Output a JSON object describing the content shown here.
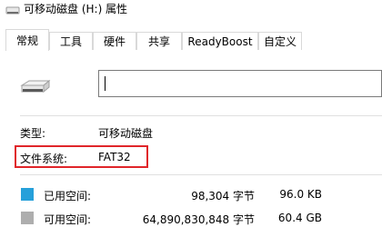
{
  "window": {
    "title": "可移动磁盘 (H:) 属性",
    "icon": "removable-drive-icon"
  },
  "tabs": [
    {
      "label": "常规",
      "active": true
    },
    {
      "label": "工具",
      "active": false
    },
    {
      "label": "硬件",
      "active": false
    },
    {
      "label": "共享",
      "active": false
    },
    {
      "label": "ReadyBoost",
      "active": false
    },
    {
      "label": "自定义",
      "active": false
    }
  ],
  "general": {
    "drive_icon": "removable-drive-icon",
    "volume_name": "",
    "type_label": "类型:",
    "type_value": "可移动磁盘",
    "fs_label": "文件系统:",
    "fs_value": "FAT32",
    "used": {
      "label": "已用空间:",
      "bytes": "98,304 字节",
      "size": "96.0 KB",
      "color": "#26a0da"
    },
    "free": {
      "label": "可用空间:",
      "bytes": "64,890,830,848 字节",
      "size": "60.4 GB",
      "color": "#aeaeae"
    }
  },
  "colors": {
    "highlight_border": "#e0252a"
  }
}
